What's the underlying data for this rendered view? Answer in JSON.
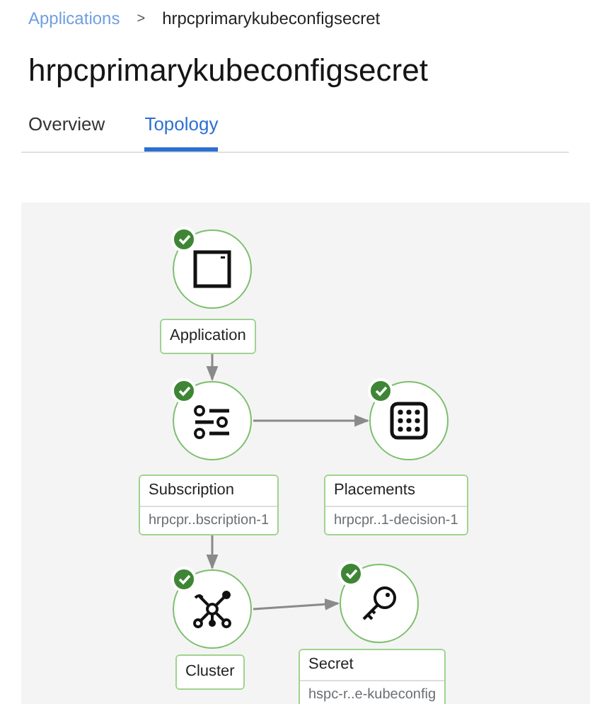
{
  "breadcrumb": {
    "link": "Applications",
    "separator": ">",
    "current": "hrpcprimarykubeconfigsecret"
  },
  "title": "hrpcprimarykubeconfigsecret",
  "tabs": [
    {
      "label": "Overview",
      "selected": false
    },
    {
      "label": "Topology",
      "selected": true
    }
  ],
  "topology": {
    "nodes": [
      {
        "kind": "application",
        "label": "Application",
        "healthy": true
      },
      {
        "kind": "subscription",
        "label": "Subscription",
        "sublabel": "hrpcpr..bscription-1",
        "healthy": true
      },
      {
        "kind": "placements",
        "label": "Placements",
        "sublabel": "hrpcpr..1-decision-1",
        "healthy": true
      },
      {
        "kind": "cluster",
        "label": "Cluster",
        "healthy": true
      },
      {
        "kind": "secret",
        "label": "Secret",
        "sublabel": "hspc-r..e-kubeconfig",
        "healthy": true
      }
    ]
  }
}
